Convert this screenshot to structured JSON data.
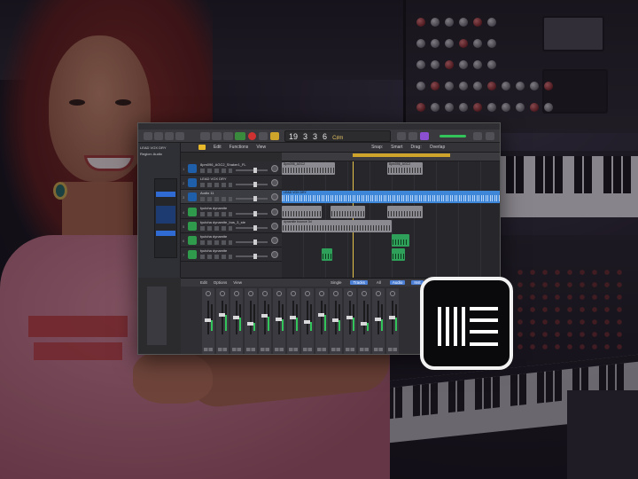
{
  "daw": {
    "lcd": {
      "bars": "19",
      "beat": "3",
      "division": "3",
      "tempo": "6",
      "key": "C♯m"
    },
    "toolbar_menu": [
      "Edit",
      "Functions",
      "View"
    ],
    "snap_label": "Snap:",
    "snap_value": "Smart",
    "drag_label": "Drag:",
    "drag_value": "Overlap",
    "inspector": {
      "region_name": "LEAD VOX DRY",
      "sub": "Region: Audio"
    },
    "tracks": [
      {
        "num": "1",
        "name": "8pm096_AGC2_Shaker1_FL",
        "type": "audio"
      },
      {
        "num": "2",
        "name": "LEAD VOX DRY",
        "type": "audio"
      },
      {
        "num": "3",
        "name": "Audio 11",
        "type": "audio",
        "selected": true
      },
      {
        "num": "4",
        "name": "tyutcha dynamite",
        "type": "midi"
      },
      {
        "num": "5",
        "name": "tyutcha dynamite_bus_3_ste",
        "type": "midi"
      },
      {
        "num": "6",
        "name": "tyutcha dynamite",
        "type": "midi"
      },
      {
        "num": "7",
        "name": "tyutcha dynamite",
        "type": "midi"
      }
    ],
    "regions": [
      {
        "track": 0,
        "color": "gray",
        "label": "8pm096_AGC2",
        "start": 0,
        "len": 0.24
      },
      {
        "track": 0,
        "color": "gray",
        "label": "8pm096_AGC2",
        "start": 0.48,
        "len": 0.16
      },
      {
        "track": 2,
        "color": "blue",
        "label": "LEAD VOX DRY",
        "start": 0,
        "len": 1.0
      },
      {
        "track": 3,
        "color": "gray",
        "label": "",
        "start": 0.0,
        "len": 0.18
      },
      {
        "track": 3,
        "color": "gray",
        "label": "",
        "start": 0.22,
        "len": 0.16
      },
      {
        "track": 3,
        "color": "gray",
        "label": "",
        "start": 0.48,
        "len": 0.16
      },
      {
        "track": 4,
        "color": "gray",
        "label": "dynamite bounce 3d",
        "start": 0,
        "len": 0.5
      },
      {
        "track": 5,
        "color": "green",
        "label": "",
        "start": 0.5,
        "len": 0.08
      },
      {
        "track": 6,
        "color": "green",
        "label": "",
        "start": 0.18,
        "len": 0.05
      },
      {
        "track": 6,
        "color": "green",
        "label": "",
        "start": 0.5,
        "len": 0.06
      }
    ],
    "mixer_menu": [
      "Edit",
      "Options",
      "View"
    ],
    "mixer_filters": [
      {
        "label": "Single",
        "on": false
      },
      {
        "label": "Tracks",
        "on": true
      },
      {
        "label": "All",
        "on": false
      },
      {
        "label": "Audio",
        "on": true
      },
      {
        "label": "Inst",
        "on": true
      },
      {
        "label": "Aux",
        "on": true
      },
      {
        "label": "Bus",
        "on": true
      }
    ],
    "mixer_levels": [
      0.4,
      0.6,
      0.5,
      0.3,
      0.55,
      0.45,
      0.5,
      0.35,
      0.6,
      0.4,
      0.5,
      0.3,
      0.45,
      0.5
    ]
  },
  "logo": {
    "name": "Ableton"
  },
  "colors": {
    "accent_yellow": "#e8b82b",
    "region_blue": "#3e86d8",
    "region_green": "#2ea05a",
    "shirt_pink": "#d98a9c"
  }
}
